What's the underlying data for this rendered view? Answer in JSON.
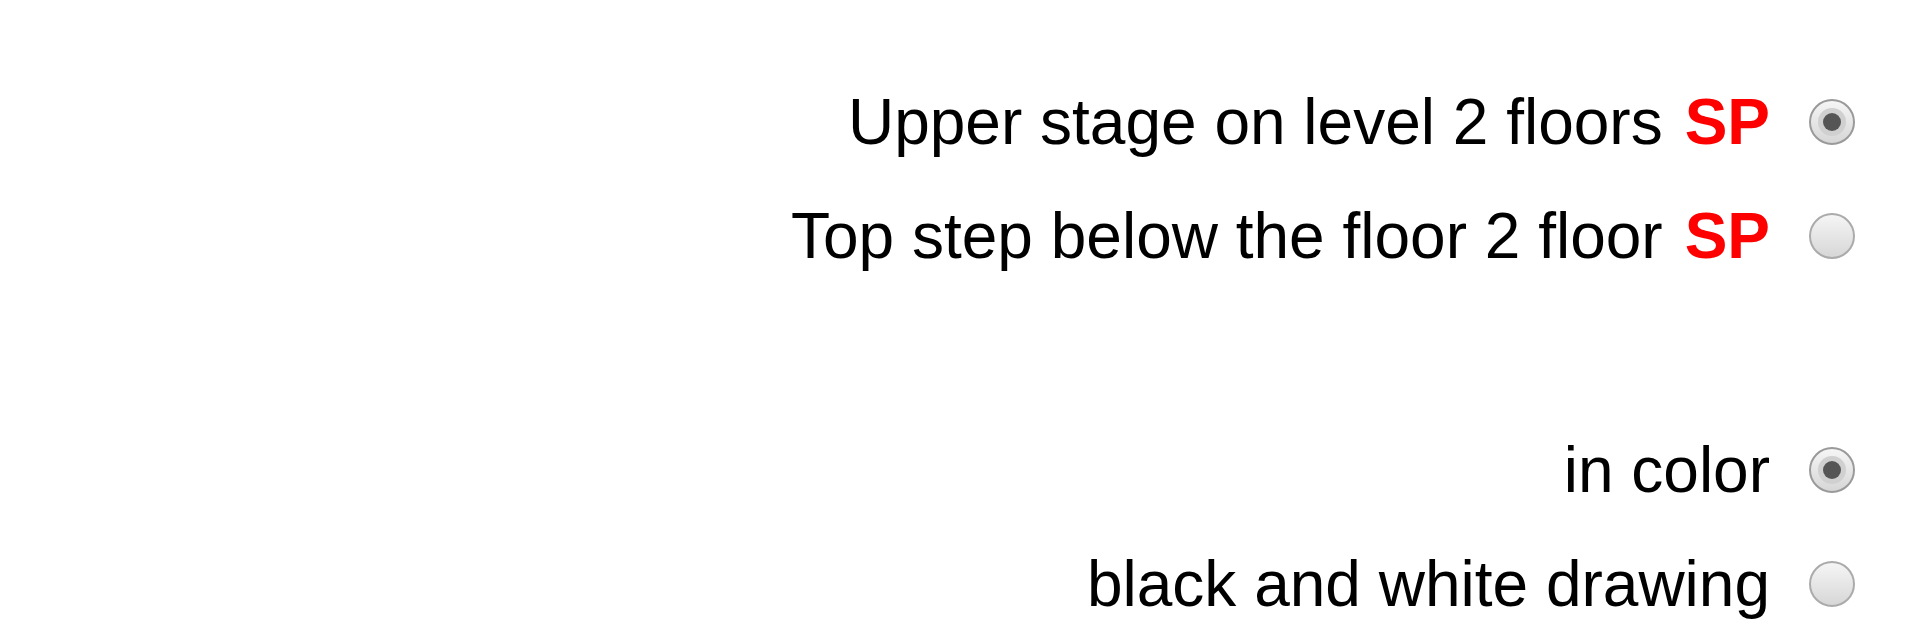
{
  "groups": [
    {
      "options": [
        {
          "label": "Upper stage on level 2 floors",
          "tag": "SP",
          "selected": true
        },
        {
          "label": "Top step below the floor 2 floor",
          "tag": "SP",
          "selected": false
        }
      ]
    },
    {
      "options": [
        {
          "label": "in color",
          "selected": true
        },
        {
          "label": "black and white drawing",
          "selected": false
        }
      ]
    }
  ]
}
